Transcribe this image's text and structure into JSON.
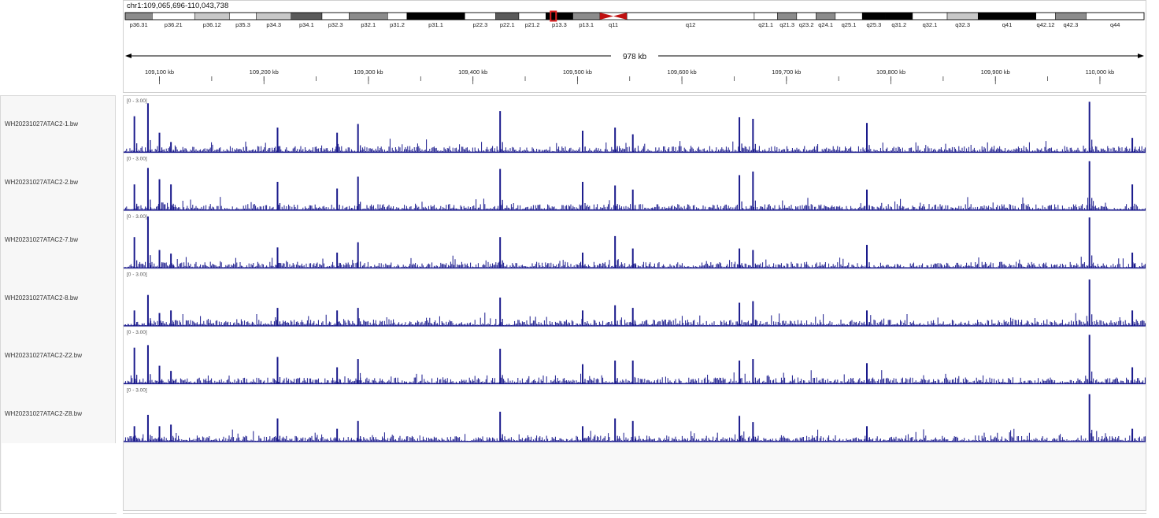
{
  "locus": "chr1:109,065,696-110,043,738",
  "span_label": "978 kb",
  "colors": {
    "track": "#1a1a8c",
    "centromere": "#c01010",
    "highlight": "#e02020"
  },
  "cytobands": [
    {
      "name": "p36.31",
      "stain": "gpos50"
    },
    {
      "name": "p36.21",
      "stain": "gneg"
    },
    {
      "name": "p36.12",
      "stain": "gpos25"
    },
    {
      "name": "p35.3",
      "stain": "gneg"
    },
    {
      "name": "p34.3",
      "stain": "gpos25"
    },
    {
      "name": "p34.1",
      "stain": "gpos75"
    },
    {
      "name": "p32.3",
      "stain": "gneg"
    },
    {
      "name": "p32.1",
      "stain": "gpos50"
    },
    {
      "name": "p31.2",
      "stain": "gneg"
    },
    {
      "name": "p31.1",
      "stain": "gpos100"
    },
    {
      "name": "p22.3",
      "stain": "gneg"
    },
    {
      "name": "p22.1",
      "stain": "gpos75"
    },
    {
      "name": "p21.2",
      "stain": "gneg"
    },
    {
      "name": "p13.3",
      "stain": "gpos100"
    },
    {
      "name": "p13.1",
      "stain": "gpos50"
    },
    {
      "name": "q11",
      "stain": "acen"
    },
    {
      "name": "q12",
      "stain": "gvar"
    },
    {
      "name": "q21.1",
      "stain": "gneg"
    },
    {
      "name": "q21.3",
      "stain": "gpos50"
    },
    {
      "name": "q23.2",
      "stain": "gneg"
    },
    {
      "name": "q24.1",
      "stain": "gpos50"
    },
    {
      "name": "q25.1",
      "stain": "gneg"
    },
    {
      "name": "q25.3",
      "stain": "gpos100"
    },
    {
      "name": "q31.2",
      "stain": "gpos100"
    },
    {
      "name": "q32.1",
      "stain": "gneg"
    },
    {
      "name": "q32.3",
      "stain": "gpos25"
    },
    {
      "name": "q41",
      "stain": "gpos100"
    },
    {
      "name": "q42.12",
      "stain": "gneg"
    },
    {
      "name": "q42.3",
      "stain": "gpos50"
    },
    {
      "name": "q44",
      "stain": "gneg"
    }
  ],
  "ruler_ticks": [
    "109,100 kb",
    "109,200 kb",
    "109,300 kb",
    "109,400 kb",
    "109,500 kb",
    "109,600 kb",
    "109,700 kb",
    "109,800 kb",
    "109,900 kb",
    "110,000 kb"
  ],
  "tracks": [
    {
      "name": "WH20231027ATAC2-1.bw",
      "range": "[0 - 3.00]",
      "seed": 11
    },
    {
      "name": "WH20231027ATAC2-2.bw",
      "range": "[0 - 3.00]",
      "seed": 23
    },
    {
      "name": "WH20231027ATAC2-7.bw",
      "range": "[0 - 3.00]",
      "seed": 37
    },
    {
      "name": "WH20231027ATAC2-8.bw",
      "range": "[0 - 3.00]",
      "seed": 49
    },
    {
      "name": "WH20231027ATAC2-Z2.bw",
      "range": "[0 - 3.00]",
      "seed": 61
    },
    {
      "name": "WH20231027ATAC2-Z8.bw",
      "range": "[0 - 3.00]",
      "seed": 73
    }
  ],
  "peaks": [
    {
      "kb": 109076,
      "h": [
        0.7,
        0.5,
        0.6,
        0.3,
        0.7,
        0.3
      ]
    },
    {
      "kb": 109089,
      "h": [
        0.95,
        0.82,
        1.0,
        0.6,
        0.75,
        0.52
      ]
    },
    {
      "kb": 109100,
      "h": [
        0.38,
        0.6,
        0.35,
        0.25,
        0.35,
        0.3
      ]
    },
    {
      "kb": 109111,
      "h": [
        0.2,
        0.5,
        0.28,
        0.3,
        0.25,
        0.33
      ]
    },
    {
      "kb": 109213,
      "h": [
        0.48,
        0.55,
        0.4,
        0.35,
        0.52,
        0.45
      ]
    },
    {
      "kb": 109270,
      "h": [
        0.38,
        0.42,
        0.3,
        0.3,
        0.32,
        0.25
      ]
    },
    {
      "kb": 109290,
      "h": [
        0.55,
        0.65,
        0.5,
        0.35,
        0.48,
        0.4
      ]
    },
    {
      "kb": 109426,
      "h": [
        0.8,
        0.8,
        0.6,
        0.55,
        0.68,
        0.58
      ]
    },
    {
      "kb": 109536,
      "h": [
        0.48,
        0.48,
        0.62,
        0.4,
        0.45,
        0.45
      ]
    },
    {
      "kb": 109553,
      "h": [
        0.35,
        0.4,
        0.38,
        0.35,
        0.45,
        0.4
      ]
    },
    {
      "kb": 109505,
      "h": [
        0.42,
        0.55,
        0.3,
        0.3,
        0.38,
        0.3
      ]
    },
    {
      "kb": 109655,
      "h": [
        0.68,
        0.68,
        0.38,
        0.45,
        0.45,
        0.5
      ]
    },
    {
      "kb": 109668,
      "h": [
        0.65,
        0.75,
        0.35,
        0.48,
        0.48,
        0.38
      ]
    },
    {
      "kb": 109777,
      "h": [
        0.57,
        0.4,
        0.45,
        0.3,
        0.4,
        0.3
      ]
    },
    {
      "kb": 109990,
      "h": [
        0.98,
        0.95,
        0.98,
        0.9,
        0.95,
        0.92
      ]
    },
    {
      "kb": 110031,
      "h": [
        0.28,
        0.5,
        0.3,
        0.3,
        0.32,
        0.25
      ]
    }
  ]
}
